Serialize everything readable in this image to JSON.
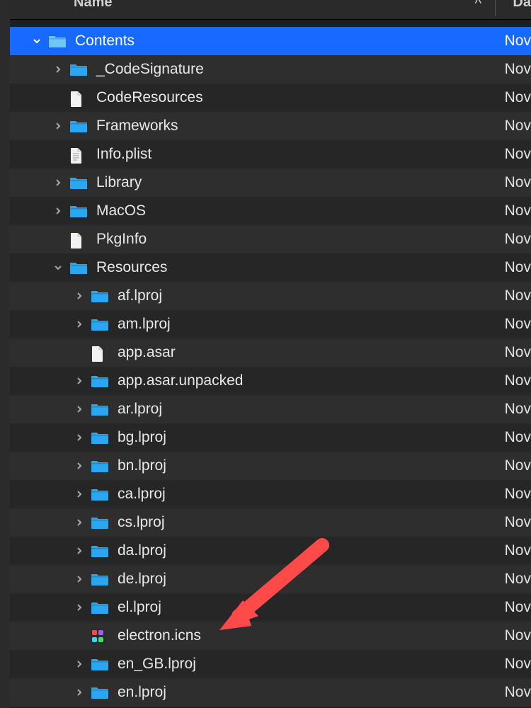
{
  "header": {
    "name_label": "Name",
    "sort_glyph": "^",
    "date_label": "Da"
  },
  "date_fragment": "Nov",
  "tree": [
    {
      "level": 0,
      "kind": "folder",
      "disclosure": "down",
      "label": "Contents",
      "selected": true
    },
    {
      "level": 1,
      "kind": "folder",
      "disclosure": "right",
      "label": "_CodeSignature"
    },
    {
      "level": 1,
      "kind": "file",
      "disclosure": "",
      "label": "CodeResources"
    },
    {
      "level": 1,
      "kind": "folder",
      "disclosure": "right",
      "label": "Frameworks"
    },
    {
      "level": 1,
      "kind": "plist",
      "disclosure": "",
      "label": "Info.plist"
    },
    {
      "level": 1,
      "kind": "folder",
      "disclosure": "right",
      "label": "Library"
    },
    {
      "level": 1,
      "kind": "folder",
      "disclosure": "right",
      "label": "MacOS"
    },
    {
      "level": 1,
      "kind": "file",
      "disclosure": "",
      "label": "PkgInfo"
    },
    {
      "level": 1,
      "kind": "folder",
      "disclosure": "down",
      "label": "Resources"
    },
    {
      "level": 2,
      "kind": "folder",
      "disclosure": "right",
      "label": "af.lproj"
    },
    {
      "level": 2,
      "kind": "folder",
      "disclosure": "right",
      "label": "am.lproj"
    },
    {
      "level": 2,
      "kind": "file",
      "disclosure": "",
      "label": "app.asar"
    },
    {
      "level": 2,
      "kind": "folder",
      "disclosure": "right",
      "label": "app.asar.unpacked"
    },
    {
      "level": 2,
      "kind": "folder",
      "disclosure": "right",
      "label": "ar.lproj"
    },
    {
      "level": 2,
      "kind": "folder",
      "disclosure": "right",
      "label": "bg.lproj"
    },
    {
      "level": 2,
      "kind": "folder",
      "disclosure": "right",
      "label": "bn.lproj"
    },
    {
      "level": 2,
      "kind": "folder",
      "disclosure": "right",
      "label": "ca.lproj"
    },
    {
      "level": 2,
      "kind": "folder",
      "disclosure": "right",
      "label": "cs.lproj"
    },
    {
      "level": 2,
      "kind": "folder",
      "disclosure": "right",
      "label": "da.lproj"
    },
    {
      "level": 2,
      "kind": "folder",
      "disclosure": "right",
      "label": "de.lproj"
    },
    {
      "level": 2,
      "kind": "folder",
      "disclosure": "right",
      "label": "el.lproj"
    },
    {
      "level": 2,
      "kind": "icns",
      "disclosure": "",
      "label": "electron.icns"
    },
    {
      "level": 2,
      "kind": "folder",
      "disclosure": "right",
      "label": "en_GB.lproj"
    },
    {
      "level": 2,
      "kind": "folder",
      "disclosure": "right",
      "label": "en.lproj"
    }
  ]
}
